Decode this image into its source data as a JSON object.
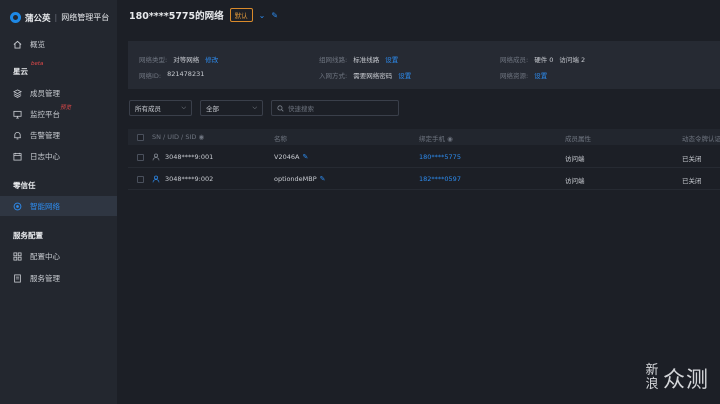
{
  "brand": {
    "name": "蒲公英",
    "separator": "|",
    "subtitle": "网络管理平台"
  },
  "sidebar": {
    "overview": "概览",
    "section_xingyun": "星云",
    "xingyun_tag": "beta",
    "member_mgmt": "成员管理",
    "monitor": "监控平台",
    "monitor_tag": "预览",
    "alert_mgmt": "告警管理",
    "log_center": "日志中心",
    "section_zero_trust": "零信任",
    "smart_network": "智能网络",
    "section_service": "服务配置",
    "config_center": "配置中心",
    "service_mgmt": "服务管理"
  },
  "topbar": {
    "network_title": "180****5775的网络",
    "default_badge": "默认"
  },
  "info": {
    "net_type_label": "网络类型:",
    "net_type_value": "对等网络",
    "net_type_action": "修改",
    "line_label": "组网线路:",
    "line_value": "标准线路",
    "line_action": "设置",
    "member_label": "网络成员:",
    "member_hw": "硬件 0",
    "member_visitor": "访问端 2",
    "netid_label": "网络ID:",
    "netid_value": "821478231",
    "join_label": "入网方式:",
    "join_value": "需要网络密码",
    "join_action": "设置",
    "resource_label": "网络资源:",
    "resource_action": "设置"
  },
  "filters": {
    "members": "所有成员",
    "all": "全部",
    "search_placeholder": "快速搜索"
  },
  "table": {
    "headers": {
      "sn": "SN / UID / SID",
      "name": "名称",
      "phone": "绑定手机",
      "attr": "成员属性",
      "dynamic": "动态令牌认证"
    },
    "rows": [
      {
        "sn": "3048****9:001",
        "name": "V2046A",
        "phone": "180****5775",
        "attr": "访问端",
        "dynamic": "已关闭"
      },
      {
        "sn": "3048****9:002",
        "name": "optiondeMBP",
        "phone": "182****0597",
        "attr": "访问端",
        "dynamic": "已关闭"
      }
    ]
  },
  "watermark": {
    "small_top": "新",
    "small_bottom": "浪",
    "big": "众测"
  }
}
